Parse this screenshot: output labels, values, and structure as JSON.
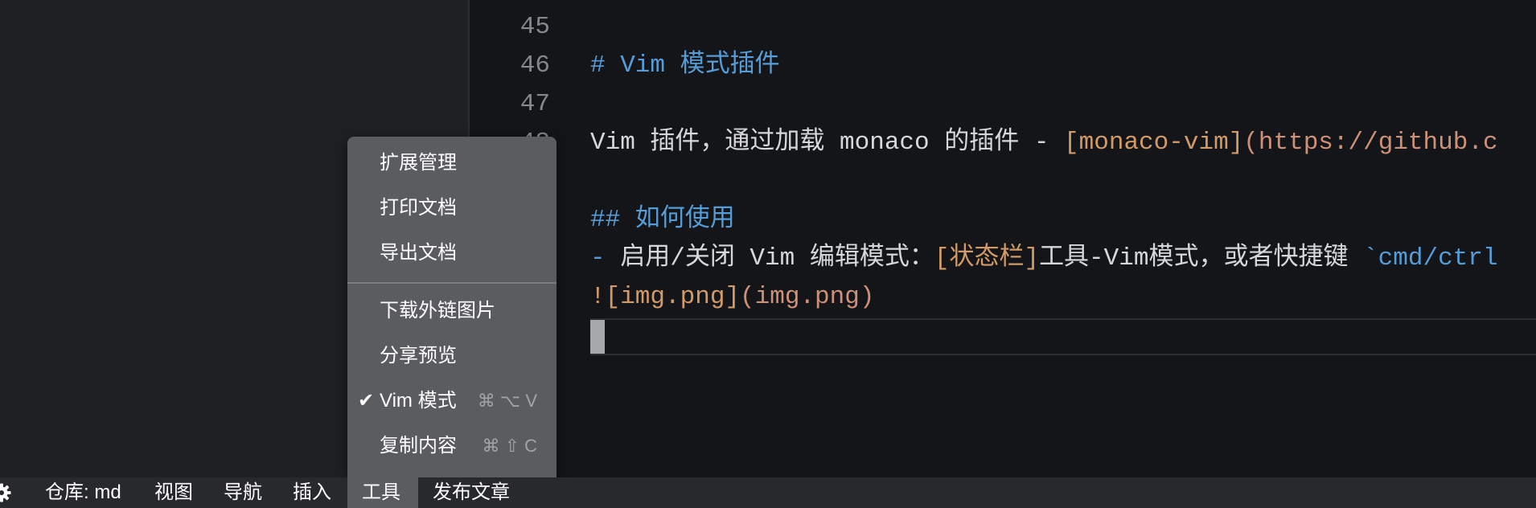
{
  "editor": {
    "line_numbers": [
      "45",
      "46",
      "47",
      "48"
    ],
    "lines": {
      "l46_heading": "# Vim 模式插件",
      "l48_text_a": "Vim 插件，通过加载 monaco 的插件 - ",
      "l48_link_text": "[monaco-vim]",
      "l48_link_url": "(https://github.c",
      "l50_heading": "## 如何使用",
      "l51_bullet": "- ",
      "l51_text_a": "启用/关闭 Vim 编辑模式：",
      "l51_bracket": "[状态栏]",
      "l51_text_b": "工具-Vim模式，或者快捷键 ",
      "l51_code": "`cmd/ctrl",
      "l52_img_alt": "![img.png]",
      "l52_img_src": "(img.png)"
    }
  },
  "tools_menu": {
    "items": [
      {
        "label": "扩展管理",
        "checked": false,
        "shortcut": ""
      },
      {
        "label": "打印文档",
        "checked": false,
        "shortcut": ""
      },
      {
        "label": "导出文档",
        "checked": false,
        "shortcut": ""
      },
      {
        "label": "下载外链图片",
        "checked": false,
        "shortcut": ""
      },
      {
        "label": "分享预览",
        "checked": false,
        "shortcut": ""
      },
      {
        "label": "Vim 模式",
        "checked": true,
        "shortcut": "⌘ ⌥ V"
      },
      {
        "label": "复制内容",
        "checked": false,
        "shortcut": "⌘ ⇧ C"
      }
    ],
    "check_glyph": "✔"
  },
  "statusbar": {
    "repo": "仓库: md",
    "view": "视图",
    "navigate": "导航",
    "insert": "插入",
    "tools": "工具",
    "publish": "发布文章"
  },
  "colors": {
    "heading": "#569cd6",
    "bracket": "#d19a66",
    "url": "#ce9178",
    "menu_bg": "#5b5c5f",
    "statusbar_bg": "#28292c"
  }
}
